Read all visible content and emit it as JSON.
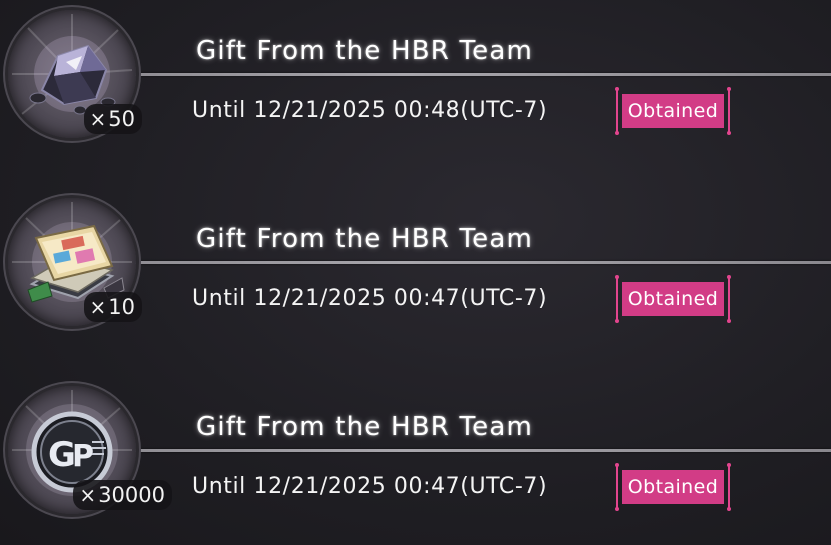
{
  "gifts": [
    {
      "title": "Gift From the HBR Team",
      "expiry": "Until 12/21/2025 00:48(UTC-7)",
      "status": "Obtained",
      "quantity_prefix": "×",
      "quantity": "50",
      "icon": "crystal-ore-icon"
    },
    {
      "title": "Gift From the HBR Team",
      "expiry": "Until 12/21/2025 00:47(UTC-7)",
      "status": "Obtained",
      "quantity_prefix": "×",
      "quantity": "10",
      "icon": "books-icon"
    },
    {
      "title": "Gift From the HBR Team",
      "expiry": "Until 12/21/2025 00:47(UTC-7)",
      "status": "Obtained",
      "quantity_prefix": "×",
      "quantity": "30000",
      "icon": "gp-coin-icon"
    }
  ],
  "colors": {
    "status_pink": "#d23c86",
    "bracket_pink": "#e2458e",
    "background": "#1f1e23"
  }
}
